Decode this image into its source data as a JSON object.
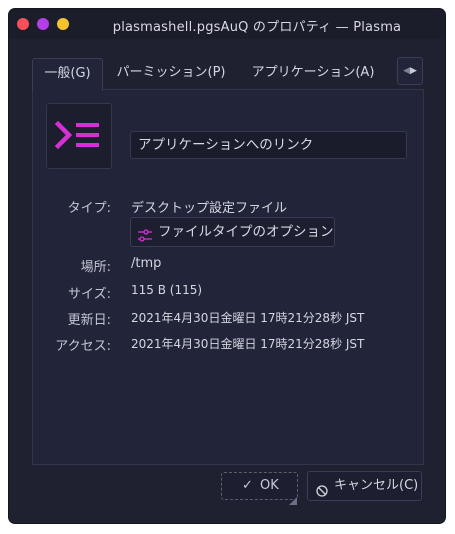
{
  "window": {
    "title": "plasmashell.pgsAuQ のプロパティ — Plasma"
  },
  "tabs": [
    {
      "label": "一般(G)",
      "active": true
    },
    {
      "label": "パーミッション(P)",
      "active": false
    },
    {
      "label": "アプリケーション(A)",
      "active": false
    }
  ],
  "general": {
    "icon": "konsole-icon",
    "name_value": "アプリケーションへのリンク",
    "type_label": "タイプ:",
    "type_value": "デスクトップ設定ファイル",
    "filetype_button_label": "ファイルタイプのオプション",
    "location_label": "場所:",
    "location_value": "/tmp",
    "size_label": "サイズ:",
    "size_value": "115 B (115)",
    "modified_label": "更新日:",
    "modified_value": "2021年4月30日金曜日 17時21分28秒 JST",
    "accessed_label": "アクセス:",
    "accessed_value": "2021年4月30日金曜日 17時21分28秒 JST"
  },
  "buttons": {
    "ok_label": "OK",
    "cancel_label": "キャンセル(C)"
  },
  "colors": {
    "accent": "#d62fd6",
    "close": "#fb4f5a",
    "maximize": "#b43ee8",
    "minimize": "#f5c32e"
  }
}
